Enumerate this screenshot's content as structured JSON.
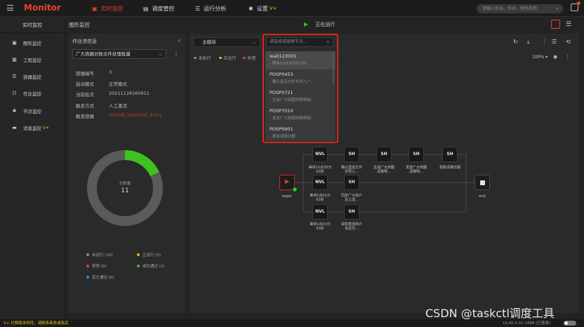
{
  "app": {
    "brand": "Monitor"
  },
  "topnav": [
    {
      "label": "实时监控",
      "icon": "▣",
      "vtag": ""
    },
    {
      "label": "调度管控",
      "icon": "▤",
      "vtag": ""
    },
    {
      "label": "运行分析",
      "icon": "☰",
      "vtag": ""
    },
    {
      "label": "设置",
      "icon": "✱",
      "vtag": "V+"
    }
  ],
  "search": {
    "placeholder": "请输入作业、作业、程序名称"
  },
  "sidebar": {
    "header": "实时监控",
    "items": [
      {
        "label": "图形监控",
        "icon": "▣",
        "vtag": ""
      },
      {
        "label": "工程监控",
        "icon": "▦",
        "vtag": ""
      },
      {
        "label": "容器监控",
        "icon": "☰",
        "vtag": ""
      },
      {
        "label": "作业监控",
        "icon": "☷",
        "vtag": ""
      },
      {
        "label": "节点监控",
        "icon": "♣",
        "vtag": ""
      },
      {
        "label": "消息监控",
        "icon": "▬",
        "vtag": "V+"
      }
    ]
  },
  "content": {
    "title": "图形监控",
    "run_status": "正在运行"
  },
  "left_panel": {
    "title": "作业流信息",
    "selected_flow": "广大商圈对账文件处理批量",
    "info": [
      {
        "label": "容器编号",
        "value": "3"
      },
      {
        "label": "启动模式",
        "value": "正常模式"
      },
      {
        "label": "当前批次",
        "value": "20211126160911"
      },
      {
        "label": "触发方式",
        "value": "人工激活"
      },
      {
        "label": "触发容器",
        "value": "GZCRB_SWZHSD_Entry"
      }
    ],
    "donut": {
      "label": "总数量",
      "total": "11",
      "completed_fraction": 0.18
    },
    "legend": [
      {
        "label": "未运行 (10)",
        "color": "#8a8a8a"
      },
      {
        "label": "正运行 (0)",
        "color": "#e8b01c"
      },
      {
        "label": "异常 (0)",
        "color": "#e8412c"
      },
      {
        "label": "成功通过 (1)",
        "color": "#33c53a"
      },
      {
        "label": "其它通过 (0)",
        "color": "#2f86e8"
      }
    ]
  },
  "graph_panel": {
    "module_select": "主模块",
    "node_search_placeholder": "请选择或搜索节点...",
    "legend": [
      {
        "label": "未执行",
        "color": "#8a8a8a"
      },
      {
        "label": "正运行",
        "color": "#e8b01c"
      },
      {
        "label": "异常",
        "color": "#e8412c"
      }
    ],
    "zoom": "100%",
    "dropdown": [
      {
        "code": "wait123001",
        "desc": "- 等待12点30分01秒"
      },
      {
        "code": "POSP0453",
        "desc": "- 确认直连文件并导入广..."
      },
      {
        "code": "POSP0721",
        "desc": "- 生成广大商圈清算明细..."
      },
      {
        "code": "POSP7010",
        "desc": "- 发送广大商圈清算明细..."
      },
      {
        "code": "POSP9901",
        "desc": "- 更新清算日期"
      }
    ],
    "flow": {
      "begin_label": "begin",
      "end_label": "end",
      "nodes": [
        {
          "text": "NVL",
          "label": "等待12点30分01秒"
        },
        {
          "text": "SH",
          "label": "确认直连文件并导入..."
        },
        {
          "text": "SH",
          "label": "生成广大商圈清算明..."
        },
        {
          "text": "SH",
          "label": "发送广大商圈清算明..."
        },
        {
          "text": "SH",
          "label": "更新清算日期"
        },
        {
          "text": "NVL",
          "label": "等待1点01分01秒"
        },
        {
          "text": "SH",
          "label": "同步广大商户及上送..."
        },
        {
          "text": "NVL",
          "label": "等待1点01分01秒"
        },
        {
          "text": "SH",
          "label": "获取直连商户信息交..."
        }
      ]
    }
  },
  "footer": {
    "left_text": "V+ 付费版本特性，请联系商务或售后",
    "right_text": "10.40.0.41:1888 [已登录]"
  },
  "watermark": "CSDN @taskctl调度工具"
}
